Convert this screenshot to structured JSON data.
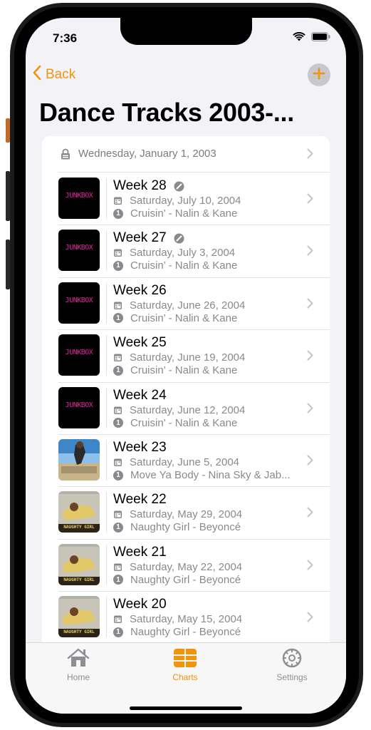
{
  "status_bar": {
    "time": "7:36"
  },
  "nav": {
    "back_label": "Back",
    "title": "Dance Tracks 2003-..."
  },
  "header_row": {
    "date": "Wednesday, January 1, 2003"
  },
  "weeks": [
    {
      "title": "Week 28",
      "date": "Saturday, July 10, 2004",
      "number_one": "Cruisin’ - Nalin & Kane",
      "rank": "1",
      "art": "junkbox",
      "flagged": true
    },
    {
      "title": "Week 27",
      "date": "Saturday, July 3, 2004",
      "number_one": "Cruisin’ - Nalin & Kane",
      "rank": "1",
      "art": "junkbox",
      "flagged": true
    },
    {
      "title": "Week 26",
      "date": "Saturday, June 26, 2004",
      "number_one": "Cruisin’ - Nalin & Kane",
      "rank": "1",
      "art": "junkbox",
      "flagged": false
    },
    {
      "title": "Week 25",
      "date": "Saturday, June 19, 2004",
      "number_one": "Cruisin’ - Nalin & Kane",
      "rank": "1",
      "art": "junkbox",
      "flagged": false
    },
    {
      "title": "Week 24",
      "date": "Saturday, June 12, 2004",
      "number_one": "Cruisin’ - Nalin & Kane",
      "rank": "1",
      "art": "junkbox",
      "flagged": false
    },
    {
      "title": "Week 23",
      "date": "Saturday, June 5, 2004",
      "number_one": "Move Ya Body - Nina Sky & Jab...",
      "rank": "1",
      "art": "beach",
      "flagged": false
    },
    {
      "title": "Week 22",
      "date": "Saturday, May 29, 2004",
      "number_one": "Naughty Girl - Beyoncé",
      "rank": "1",
      "art": "naughty",
      "flagged": false
    },
    {
      "title": "Week 21",
      "date": "Saturday, May 22, 2004",
      "number_one": "Naughty Girl - Beyoncé",
      "rank": "1",
      "art": "naughty",
      "flagged": false
    },
    {
      "title": "Week 20",
      "date": "Saturday, May 15, 2004",
      "number_one": "Naughty Girl - Beyoncé",
      "rank": "1",
      "art": "naughty",
      "flagged": false
    }
  ],
  "art_text": {
    "junkbox": "JUNKBOX",
    "naughty": "NAUGHTY GIRL"
  },
  "tabs": [
    {
      "label": "Home",
      "icon": "house-icon",
      "selected": false
    },
    {
      "label": "Charts",
      "icon": "charts-icon",
      "selected": true
    },
    {
      "label": "Settings",
      "icon": "gear-icon",
      "selected": false
    }
  ],
  "colors": {
    "accent": "#f0940a",
    "junkbox_text": "#e0249c",
    "secondary_text": "#8a8a8e",
    "tab_inactive": "#8e8e93"
  }
}
